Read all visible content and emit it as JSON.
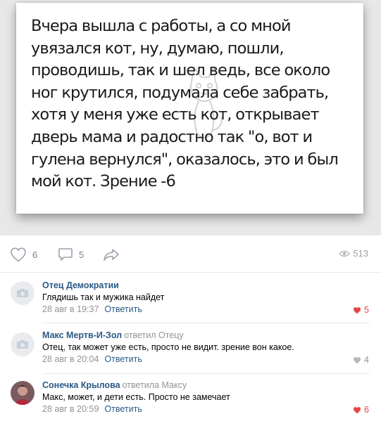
{
  "post": {
    "image_text": "Вчера вышла с работы, а со мной\nувязался кот, ну, думаю, пошли,\nпроводишь, так и шел ведь, все около\nног крутился, подумала себе забрать,\nхотя у меня уже есть кот, открывает\nдверь мама и радостно так \"о, вот и\nгулена вернулся\", оказалось, это и был\nмой кот. Зрение -6"
  },
  "actions": {
    "likes": "6",
    "comments": "5",
    "views": "513"
  },
  "comments": [
    {
      "author": "Отец Демократии",
      "replied_to": "",
      "text": "Глядишь так и мужика найдет",
      "date": "28 авг в 19:37",
      "reply_label": "Ответить",
      "likes": "5",
      "liked": true
    },
    {
      "author": "Макс Мертв-И-Зол",
      "replied_to": "ответил Отецу",
      "text": "Отец, так может уже есть, просто не видит. зрение вон какое.",
      "date": "28 авг в 20:04",
      "reply_label": "Ответить",
      "likes": "4",
      "liked": false
    },
    {
      "author": "Сонечка Крылова",
      "replied_to": "ответила Максу",
      "text": "Макс, может, и дети есть. Просто не замечает",
      "date": "28 авг в 20:59",
      "reply_label": "Ответить",
      "likes": "6",
      "liked": true
    }
  ],
  "colors": {
    "link": "#2a5885",
    "muted": "#939393",
    "like_active": "#e64646",
    "divider": "#e7e8ec"
  }
}
